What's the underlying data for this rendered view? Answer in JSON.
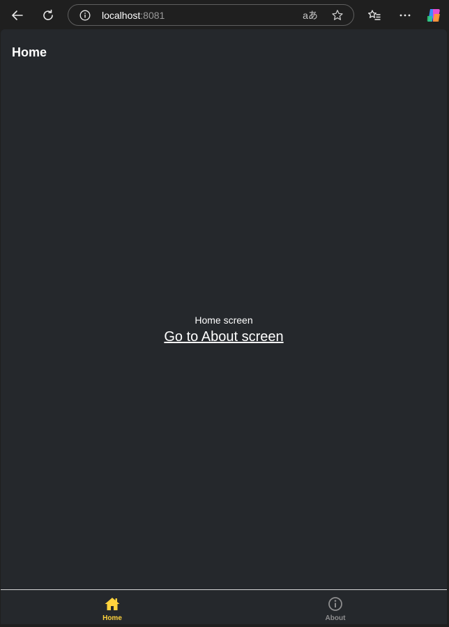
{
  "browser": {
    "address": {
      "host": "localhost",
      "port": ":8081"
    },
    "translate_glyph": "aあ",
    "icons": {
      "back": "back-arrow-icon",
      "refresh": "refresh-icon",
      "site_info": "info-icon",
      "translate": "translate-icon",
      "favorite": "star-icon",
      "favorites": "favorites-icon",
      "menu": "more-icon",
      "copilot": "copilot-icon"
    }
  },
  "app": {
    "header_title": "Home",
    "screen_text": "Home screen",
    "link_text": "Go to About screen",
    "tabs": [
      {
        "label": "Home",
        "icon": "home-icon",
        "active": true,
        "color": "#ffd33d"
      },
      {
        "label": "About",
        "icon": "info-circle-icon",
        "active": false,
        "color": "#8e8e8f"
      }
    ]
  },
  "colors": {
    "background": "#25282c",
    "accent": "#ffd33d",
    "text": "#ffffff"
  }
}
